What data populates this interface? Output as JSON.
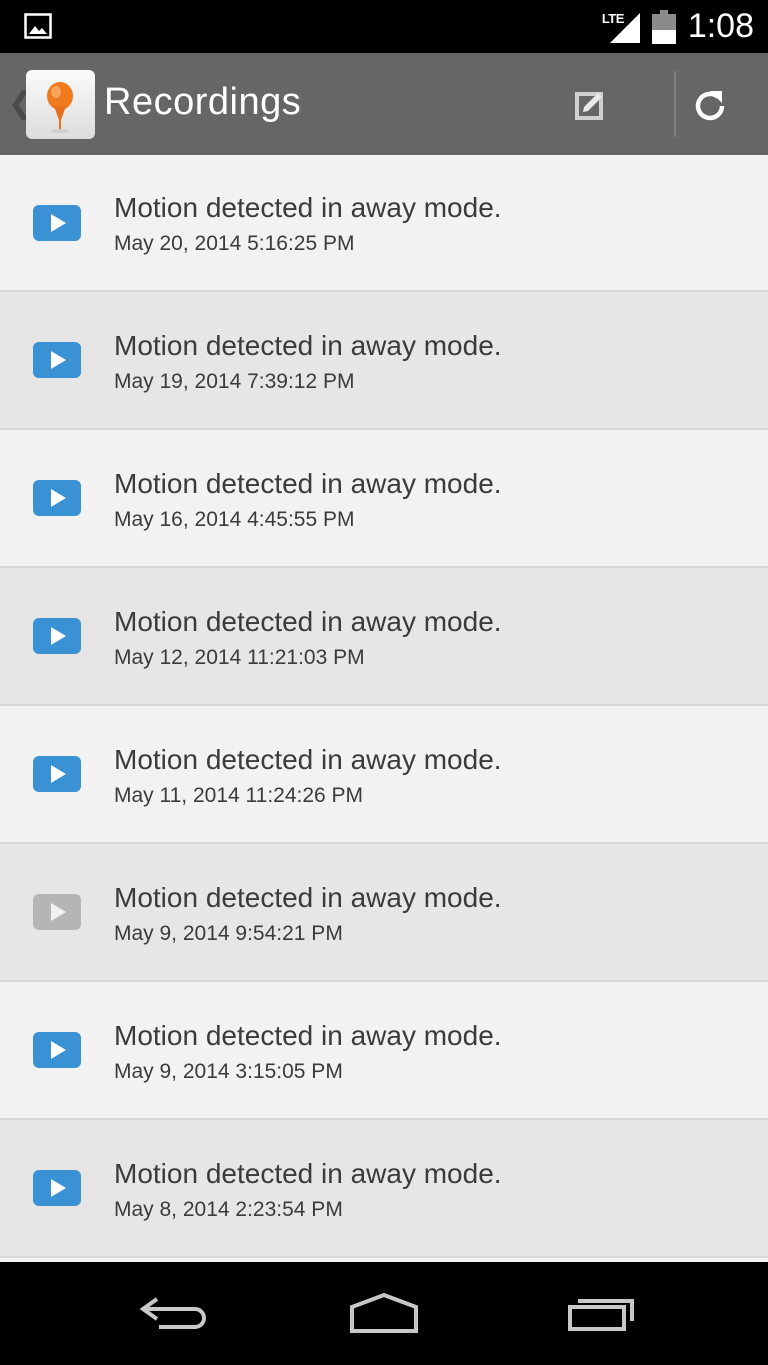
{
  "status_bar": {
    "network": "LTE",
    "time": "1:08",
    "notification_icon": "image-icon"
  },
  "action_bar": {
    "title": "Recordings",
    "back_icon": "back-caret-icon",
    "app_icon": "pin-icon",
    "edit_icon": "edit-icon",
    "refresh_icon": "refresh-icon"
  },
  "recordings": [
    {
      "title": "Motion detected in away mode.",
      "date": "May 20, 2014 5:16:25 PM",
      "watched": false
    },
    {
      "title": "Motion detected in away mode.",
      "date": "May 19, 2014 7:39:12 PM",
      "watched": false
    },
    {
      "title": "Motion detected in away mode.",
      "date": "May 16, 2014 4:45:55 PM",
      "watched": false
    },
    {
      "title": "Motion detected in away mode.",
      "date": "May 12, 2014 11:21:03 PM",
      "watched": false
    },
    {
      "title": "Motion detected in away mode.",
      "date": "May 11, 2014 11:24:26 PM",
      "watched": false
    },
    {
      "title": "Motion detected in away mode.",
      "date": "May 9, 2014 9:54:21 PM",
      "watched": true
    },
    {
      "title": "Motion detected in away mode.",
      "date": "May 9, 2014 3:15:05 PM",
      "watched": false
    },
    {
      "title": "Motion detected in away mode.",
      "date": "May 8, 2014 2:23:54 PM",
      "watched": false
    }
  ],
  "colors": {
    "play_active": "#3a92d4",
    "play_watched": "#b5b5b5",
    "action_bar": "#666666",
    "row_light": "#f2f2f2",
    "row_dark": "#e6e6e6"
  },
  "nav_bar": {
    "back_icon": "back-icon",
    "home_icon": "home-icon",
    "recents_icon": "recents-icon"
  }
}
